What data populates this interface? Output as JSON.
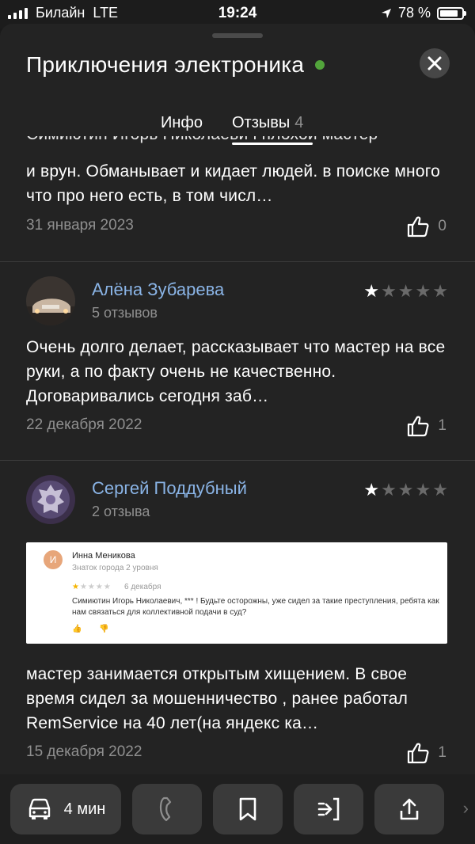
{
  "status_bar": {
    "carrier": "Билайн",
    "network": "LTE",
    "time": "19:24",
    "battery": "78 %",
    "icons": [
      "signal-icon",
      "location-arrow-icon",
      "battery-icon"
    ]
  },
  "header": {
    "title": "Приключения электроника",
    "online_color": "#52a43b",
    "close_icon": "close-icon"
  },
  "tabs": {
    "info_label": "Инфо",
    "reviews_label": "Отзывы",
    "reviews_count": "4"
  },
  "reviews": [
    {
      "text_partial_top": "Симиютин Игорь Николаевич плохой мастер",
      "text": "и врун. Обманывает и кидает людей. в поиске много что про него есть, в том числ…",
      "date": "31 января 2023",
      "likes": "0"
    },
    {
      "author": "Алёна Зубарева",
      "author_reviews": "5 отзывов",
      "rating": 1,
      "text": "Очень долго делает, рассказывает что мастер на все руки, а по факту очень не качественно. Договаривались сегодня заб…",
      "date": "22 декабря 2022",
      "likes": "1"
    },
    {
      "author": "Сергей Поддубный",
      "author_reviews": "2 отзыва",
      "rating": 1,
      "embedded": {
        "initial": "И",
        "name": "Инна Меникова",
        "level": "Знаток города 2 уровня",
        "date": "6 декабря",
        "text": "Симиютин Игорь Николаевич, *** ! Будьте осторожны, уже сидел за такие преступления, ребята как нам связаться для коллективной подачи в суд?"
      },
      "text": "мастер занимается открытым хищением. В свое время сидел за мошенничество , ранее работал RemService на 40 лет(на яндекс ка…",
      "date": "15 декабря 2022",
      "likes": "1"
    }
  ],
  "bottom_bar": {
    "route_time": "4 мин",
    "icons": [
      "car-icon",
      "phone-icon",
      "bookmark-icon",
      "route-icon",
      "share-icon",
      "chevron-right-icon"
    ]
  }
}
